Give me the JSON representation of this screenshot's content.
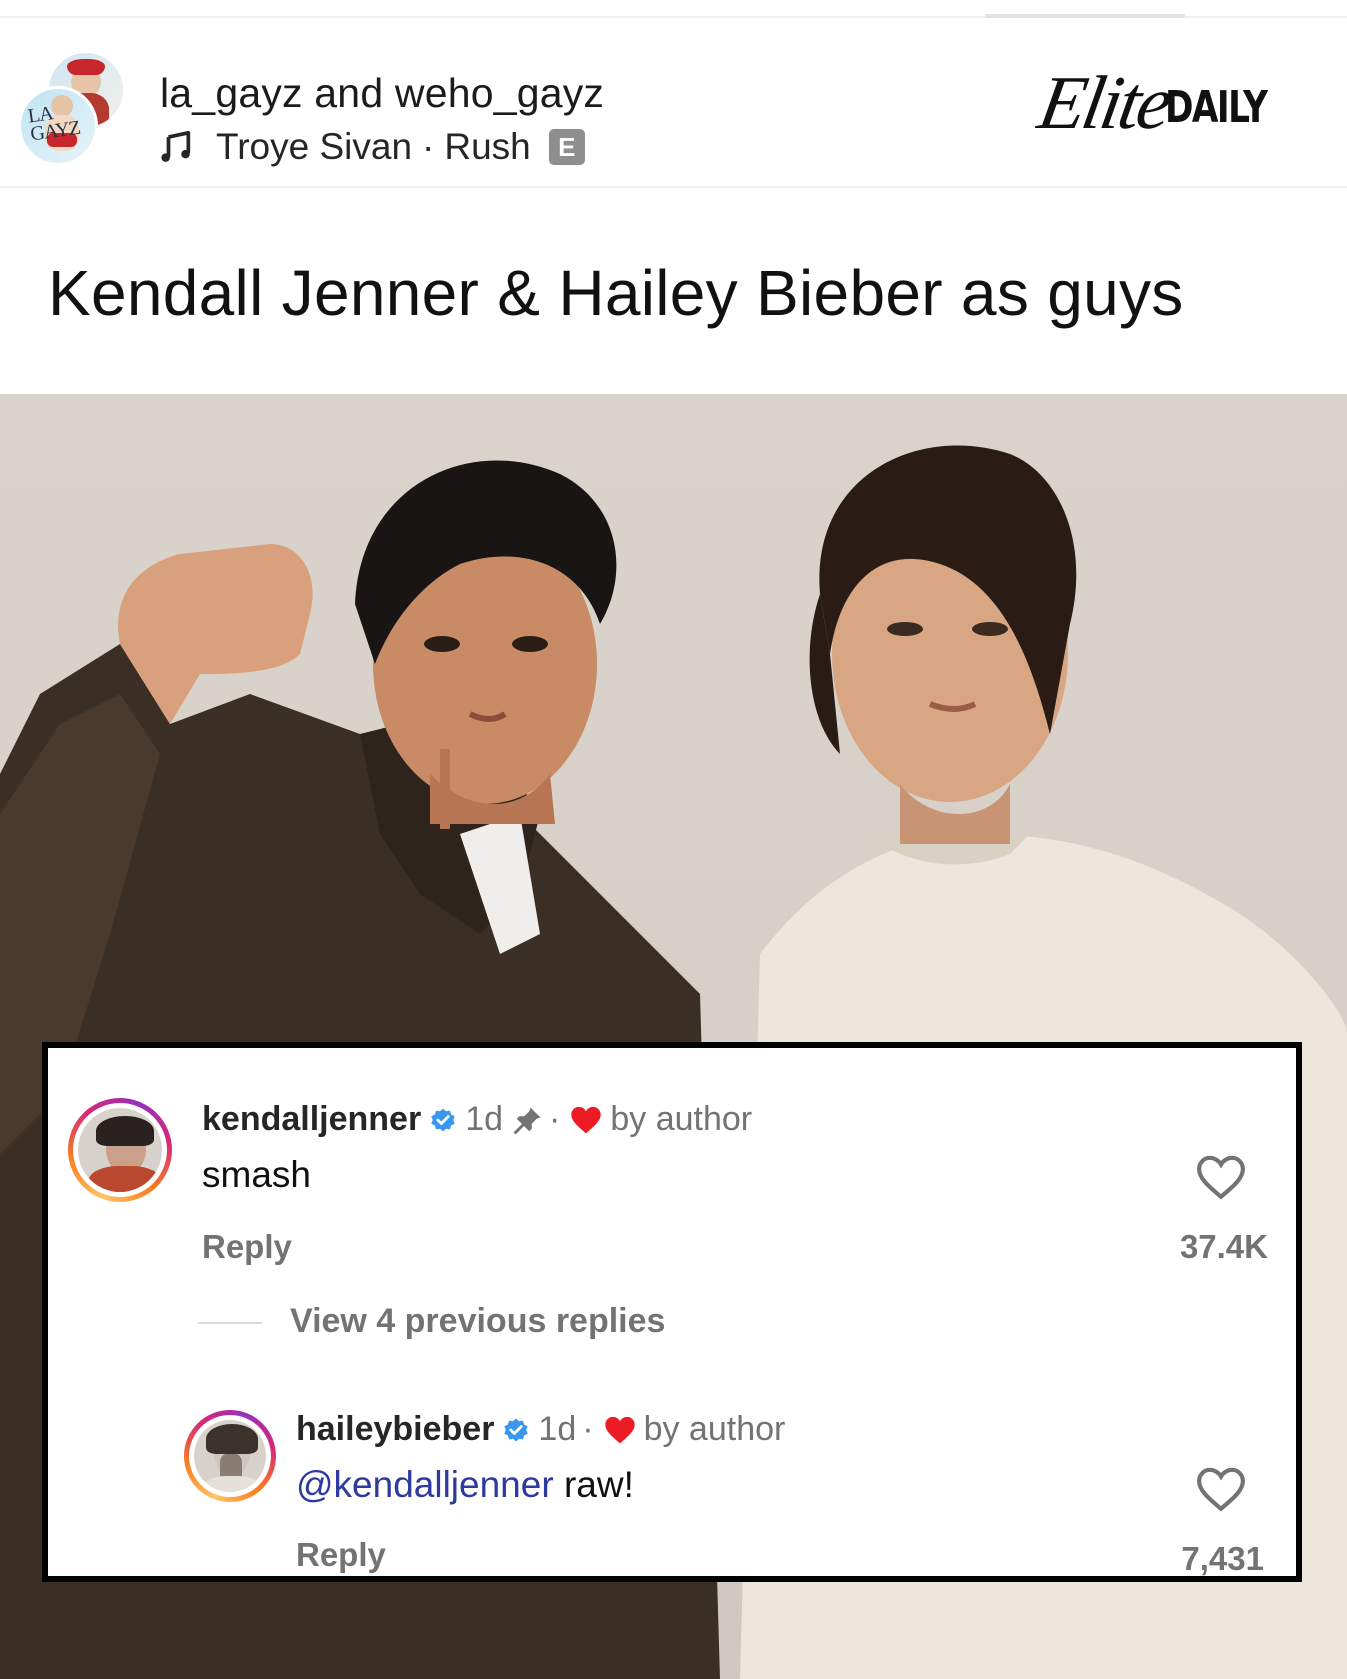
{
  "post": {
    "accounts": "la_gayz and weho_gayz",
    "avatar_text": "LA GAYZ",
    "audio": {
      "artist": "Troye Sivan",
      "separator": "·",
      "track": "Rush",
      "explicit": "E"
    },
    "brand": {
      "elite": "Elite",
      "daily": "DAILY"
    },
    "caption": "Kendall Jenner & Hailey Bieber as guys"
  },
  "comments": [
    {
      "username": "kendalljenner",
      "time": "1d",
      "sep": "·",
      "liked_by": "by author",
      "text": "smash",
      "reply_label": "Reply",
      "likes": "37.4K",
      "pinned": true
    },
    {
      "username": "haileybieber",
      "time": "1d",
      "sep": "·",
      "liked_by": "by author",
      "mention": "@kendalljenner",
      "text": " raw!",
      "reply_label": "Reply",
      "likes": "7,431"
    }
  ],
  "view_replies": "View 4 previous replies",
  "colors": {
    "verified": "#3897f0",
    "heart": "#ed1c24",
    "mention": "#2e3aa0",
    "muted": "#737373"
  },
  "icons": [
    "music-note-icon",
    "explicit-badge",
    "verified-icon",
    "pin-icon",
    "heart-icon",
    "like-outline-icon"
  ]
}
